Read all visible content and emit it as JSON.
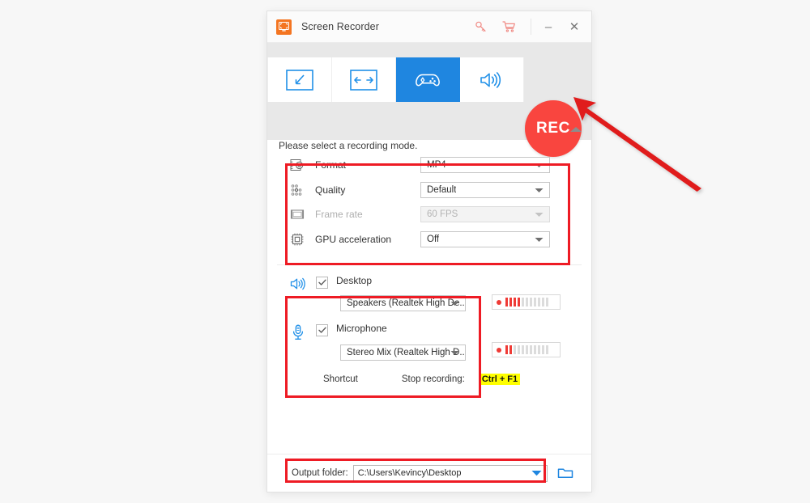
{
  "window": {
    "title": "Screen Recorder",
    "app_icon": "screen-recorder-icon",
    "titlebar_icons": [
      "key-icon",
      "cart-icon"
    ],
    "minimize_label": "–",
    "close_label": "✕"
  },
  "modebar": {
    "modes": [
      {
        "id": "custom-region",
        "icon": "custom-region-icon",
        "active": false
      },
      {
        "id": "full-screen",
        "icon": "full-screen-icon",
        "active": false
      },
      {
        "id": "game-mode",
        "icon": "game-controller-icon",
        "active": true
      },
      {
        "id": "audio-only",
        "icon": "speaker-icon",
        "active": false
      }
    ],
    "rec_label": "REC",
    "hint": "Please select a recording mode.",
    "collapse_icon": "chevron-up-icon"
  },
  "settings": {
    "rows": [
      {
        "icon": "film-gear-icon",
        "label": "Format",
        "value": "MP4",
        "disabled": false
      },
      {
        "icon": "quality-dots-icon",
        "label": "Quality",
        "value": "Default",
        "disabled": false
      },
      {
        "icon": "frame-rate-icon",
        "label": "Frame rate",
        "value": "60 FPS",
        "disabled": true
      },
      {
        "icon": "gpu-chip-icon",
        "label": "GPU acceleration",
        "value": "Off",
        "disabled": false
      }
    ]
  },
  "audio": {
    "desktop": {
      "icon": "speaker-icon",
      "label": "Desktop",
      "checked": true,
      "device": "Speakers (Realtek High De...",
      "meter_total": 11,
      "meter_active": 4
    },
    "microphone": {
      "icon": "microphone-icon",
      "label": "Microphone",
      "checked": true,
      "device": "Stereo Mix (Realtek High D...",
      "meter_total": 11,
      "meter_active": 2
    }
  },
  "shortcut": {
    "label": "Shortcut",
    "action": "Stop recording:",
    "keys": "Ctrl + F1"
  },
  "output": {
    "label": "Output folder:",
    "path": "C:\\Users\\Kevincy\\Desktop",
    "dropdown_icon": "chevron-down-icon",
    "browse_icon": "folder-icon"
  },
  "annotation": {
    "arrow": "red-arrow-pointing-to-rec-button",
    "arrow_color": "#e01b1b"
  },
  "colors": {
    "accent_blue": "#1f86e0",
    "rec_red": "#f9453f",
    "highlight_red": "#ee1b24",
    "app_orange": "#f47521",
    "shortcut_highlight": "#ffff00"
  }
}
